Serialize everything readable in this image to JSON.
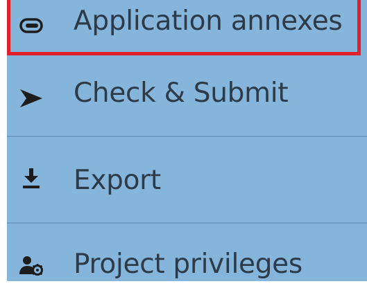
{
  "menu": {
    "items": [
      {
        "label": "Application annexes",
        "icon": "paperclip-icon"
      },
      {
        "label": "Check & Submit",
        "icon": "send-icon"
      },
      {
        "label": "Export",
        "icon": "download-icon"
      },
      {
        "label": "Project privileges",
        "icon": "user-gear-icon"
      }
    ]
  },
  "colors": {
    "panel_background": "#86b5dc",
    "text": "#2d3a48",
    "divider": "#6f9cc2",
    "highlight": "#e0202b"
  }
}
